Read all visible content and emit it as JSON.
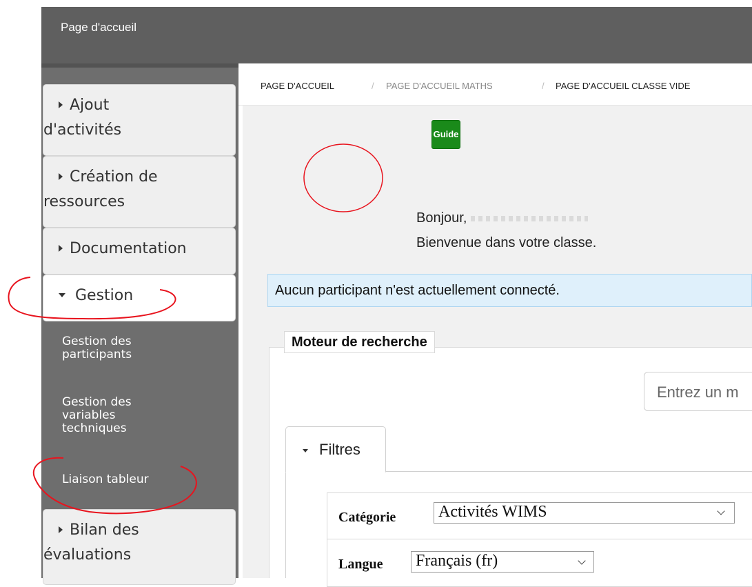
{
  "window": {
    "title": "Page d'accueil"
  },
  "sidebar": {
    "items": [
      {
        "lines": [
          "Ajout",
          "d'activités"
        ]
      },
      {
        "lines": [
          "Création de",
          "ressources"
        ]
      },
      {
        "lines": [
          "Documentation"
        ]
      },
      {
        "lines": [
          "Gestion"
        ]
      },
      {
        "lines": [
          "Bilan des",
          "évaluations"
        ]
      }
    ],
    "sub_items": [
      {
        "lines": [
          "Gestion des",
          "participants"
        ]
      },
      {
        "lines": [
          "Gestion des",
          "variables",
          "techniques"
        ]
      },
      {
        "lines": [
          "Liaison tableur"
        ]
      }
    ]
  },
  "breadcrumb": {
    "items": [
      "Page d'accueil",
      "Page d'accueil Maths",
      "Page d'accueil classe vide"
    ],
    "separator": "/"
  },
  "main": {
    "greeting": "Bonjour,",
    "welcome": "Bienvenue dans votre classe.",
    "guide_label": "Guide",
    "notice": "Aucun participant n'est actuellement connecté.",
    "search_engine": {
      "legend": "Moteur de recherche",
      "input_placeholder": "Entrez un m"
    },
    "filters": {
      "tab_label": "Filtres",
      "category_label": "Catégorie",
      "category_value": "Activités WIMS",
      "language_label": "Langue",
      "language_value": "Français (fr)"
    }
  },
  "colors": {
    "topbar": "#5f5f5f",
    "sidebar": "#6e6e6e",
    "guide_button": "#1a8a1a",
    "notice_bg": "#dff0fb",
    "annotation": "#e8141e"
  }
}
